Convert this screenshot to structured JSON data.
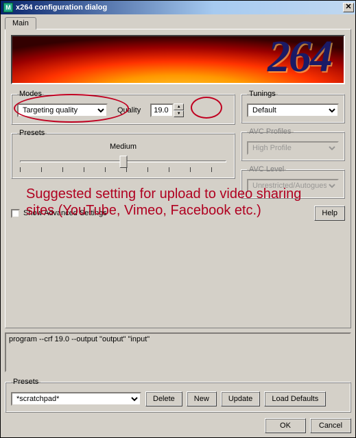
{
  "title": "x264 configuration dialog",
  "banner_text": "264",
  "tabs": {
    "main": "Main"
  },
  "modes": {
    "legend": "Modes",
    "select_value": "Targeting quality",
    "quality_label": "Quality",
    "quality_value": "19.0"
  },
  "tunings": {
    "legend": "Tunings",
    "value": "Default"
  },
  "avc_profiles": {
    "legend": "AVC Profiles",
    "value": "High Profile"
  },
  "avc_level": {
    "legend": "AVC Level",
    "value": "Unrestricted/Autoguess"
  },
  "presets_slider": {
    "legend": "Presets",
    "value_label": "Medium"
  },
  "annotation": "Suggested setting for upload to video sharing sites (YouTube, Vimeo, Facebook etc.)",
  "advanced": {
    "show_label": "Show Advanced Settings",
    "help": "Help"
  },
  "command_line": "program --crf 19.0 --output \"output\" \"input\"",
  "bottom_presets": {
    "legend": "Presets",
    "value": "*scratchpad*",
    "delete": "Delete",
    "new": "New",
    "update": "Update",
    "load_defaults": "Load Defaults"
  },
  "dialog_buttons": {
    "ok": "OK",
    "cancel": "Cancel"
  }
}
